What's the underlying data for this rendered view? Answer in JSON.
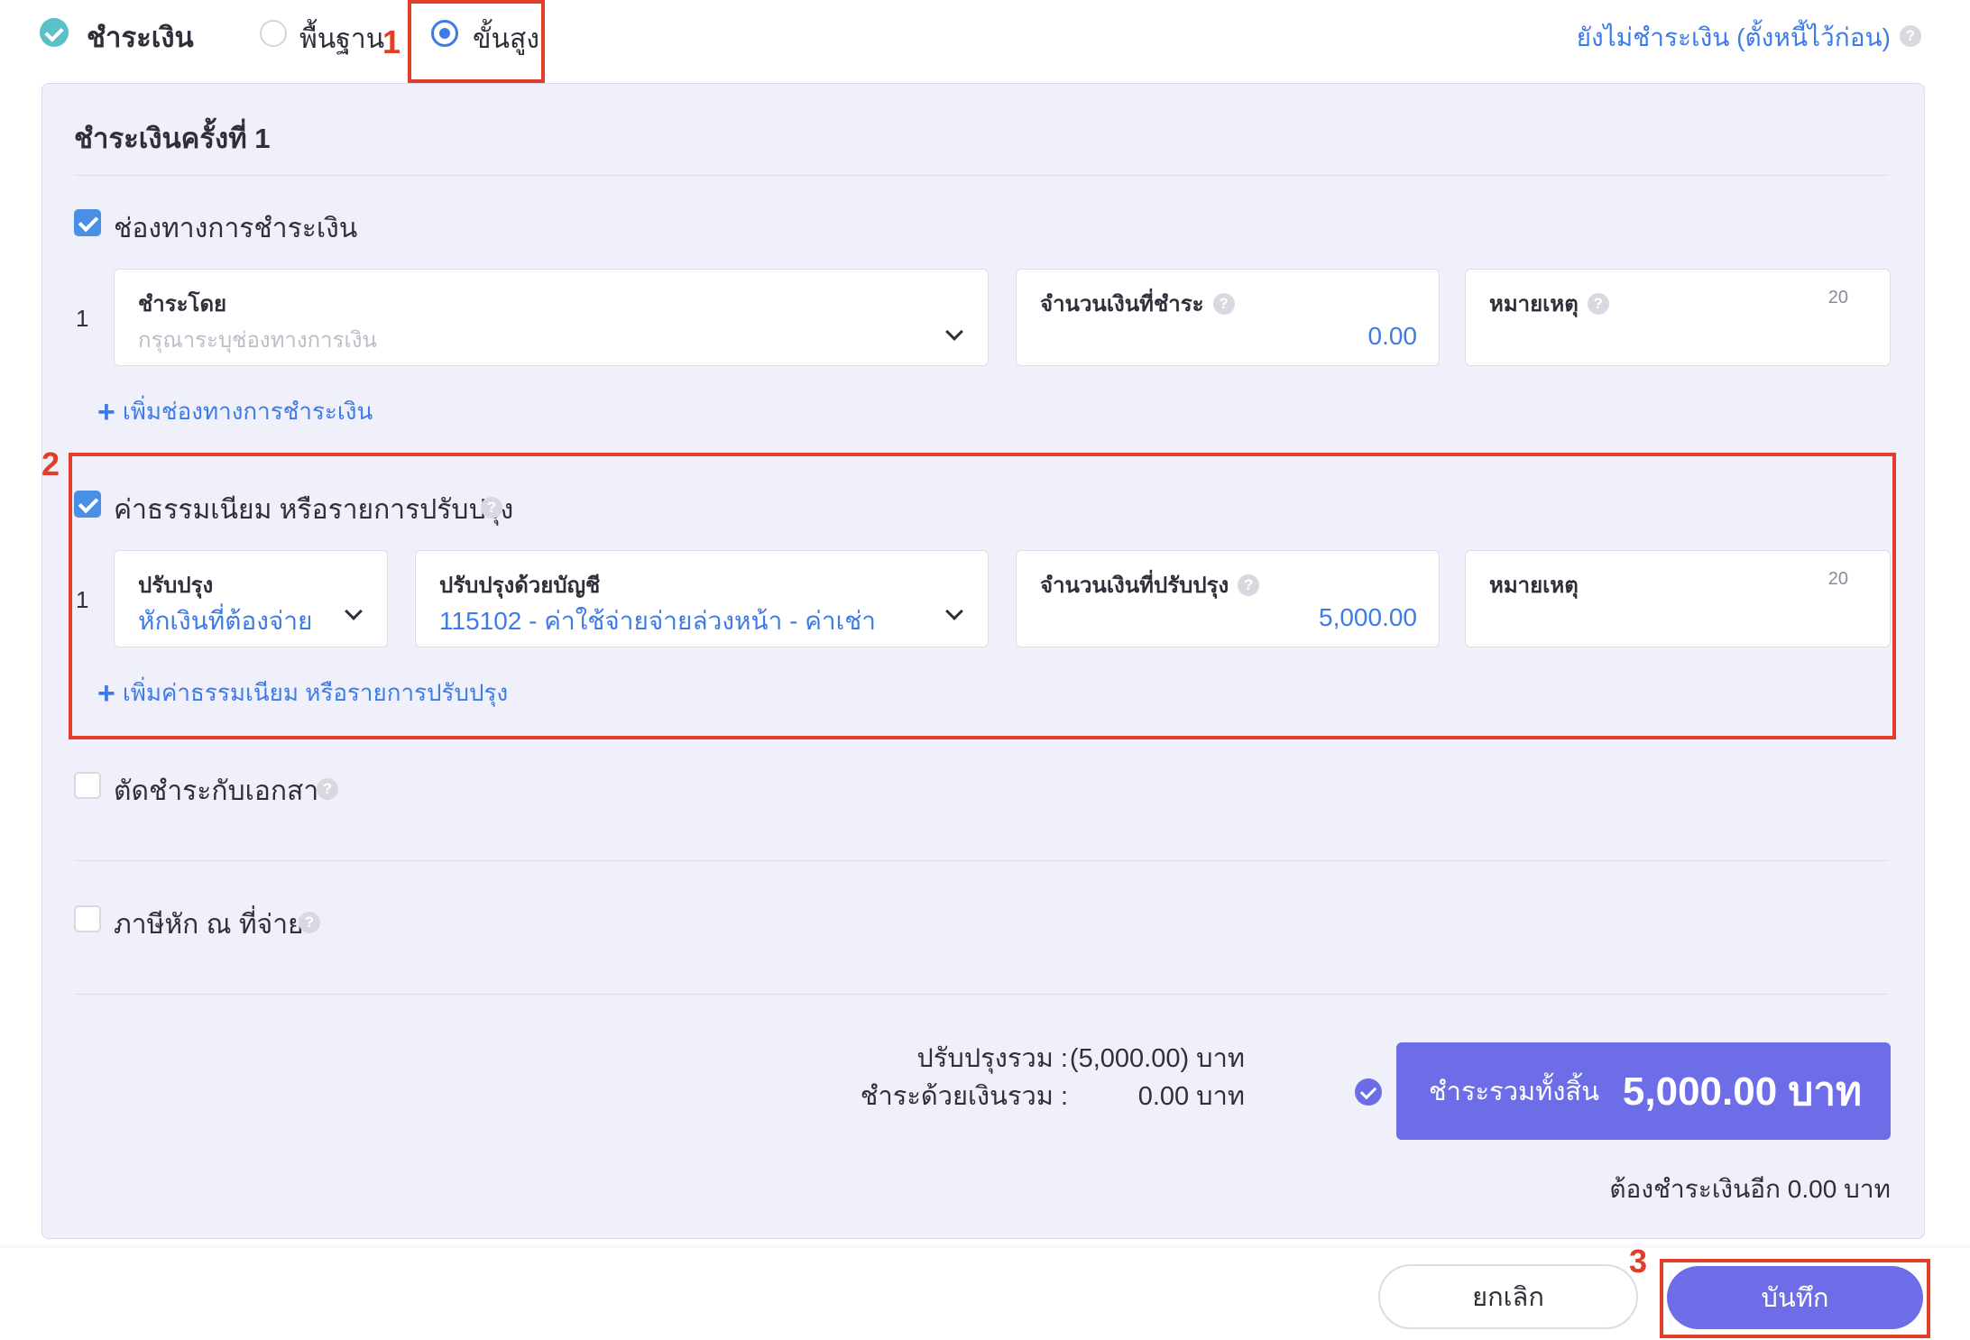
{
  "header": {
    "title": "ชำระเงิน",
    "mode_basic": "พื้นฐาน",
    "mode_advanced": "ขั้นสูง",
    "unpaid_link": "ยังไม่ชำระเงิน (ตั้งหนี้ไว้ก่อน)",
    "selected_mode": "advanced"
  },
  "annotations": {
    "a1": "1",
    "a2": "2",
    "a3": "3"
  },
  "help_glyph": "?",
  "payment": {
    "title": "ชำระเงินครั้งที่ 1",
    "channel_section": {
      "label": "ช่องทางการชำระเงิน",
      "checked": true,
      "row_number": "1",
      "pay_by_label": "ชำระโดย",
      "pay_by_placeholder": "กรุณาระบุช่องทางการเงิน",
      "amount_label": "จำนวนเงินที่ชำระ",
      "amount_value": "0.00",
      "note_label": "หมายเหตุ",
      "note_limit": "20",
      "add_link": "เพิ่มช่องทางการชำระเงิน"
    },
    "fee_section": {
      "label": "ค่าธรรมเนียม หรือรายการปรับปรุง",
      "checked": true,
      "row_number": "1",
      "adjust_label": "ปรับปรุง",
      "adjust_value": "หักเงินที่ต้องจ่าย",
      "account_label": "ปรับปรุงด้วยบัญชี",
      "account_value": "115102 - ค่าใช้จ่ายจ่ายล่วงหน้า - ค่าเช่า",
      "amount_label": "จำนวนเงินที่ปรับปรุง",
      "amount_value": "5,000.00",
      "note_label": "หมายเหตุ",
      "note_limit": "20",
      "add_link": "เพิ่มค่าธรรมเนียม หรือรายการปรับปรุง"
    },
    "offset_doc": {
      "label": "ตัดชำระกับเอกสาร",
      "checked": false
    },
    "withholding": {
      "label": "ภาษีหัก ณ ที่จ่าย",
      "checked": false
    },
    "summary": {
      "adjust_total_label": "ปรับปรุงรวม :",
      "adjust_total_value": "(5,000.00) บาท",
      "cash_total_label": "ชำระด้วยเงินรวม :",
      "cash_total_value": "0.00 บาท",
      "grand_total_label": "ชำระรวมทั้งสิ้น",
      "grand_total_value": "5,000.00 บาท",
      "remaining": "ต้องชำระเงินอีก 0.00 บาท"
    }
  },
  "footer": {
    "cancel_label": "ยกเลิก",
    "save_label": "บันทึก"
  },
  "colors": {
    "accent": "#3d7be6",
    "primary": "#6d6de8",
    "annotation": "#e23d28",
    "panel_bg": "#f0f0fb"
  }
}
